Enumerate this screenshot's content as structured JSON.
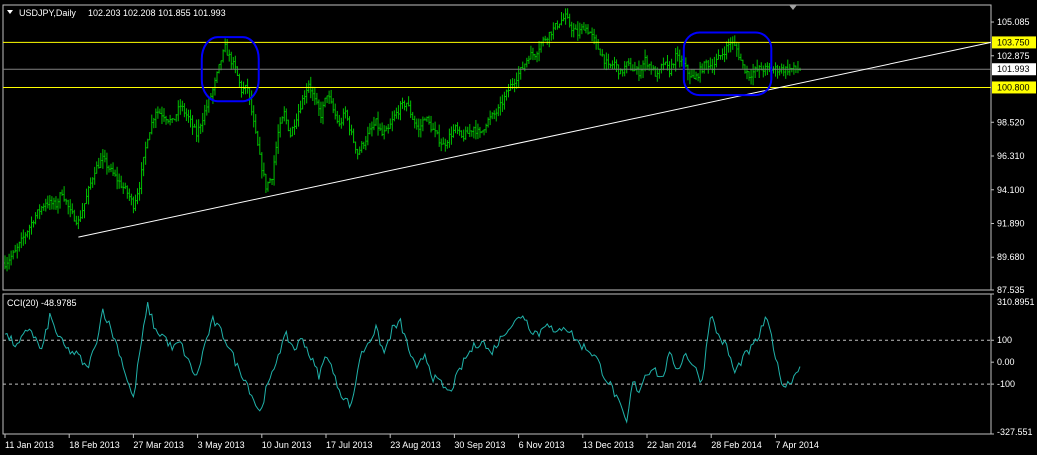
{
  "header": {
    "symbol": "USDJPY,Daily",
    "ohlc": "102.203 102.208 101.855 101.993",
    "menu_icon": "triangle-down-icon"
  },
  "indicator": {
    "label": "CCI(20) -48.9785"
  },
  "colors": {
    "background": "#000000",
    "frame": "#c0c0c0",
    "bars": "#00c000",
    "cci": "#20b2aa",
    "support_line": "#ffffff",
    "level_line": "#ffff00",
    "ellipse": "#0000ff",
    "axis_text": "#ffffff",
    "level_label_bg": "#ffff00",
    "level_label_text": "#000000"
  },
  "chart_data": [
    {
      "type": "ohlc",
      "ylim": [
        87.535,
        106.2
      ],
      "y_ticks": [
        "105.085",
        "102.875",
        "98.520",
        "96.310",
        "94.100",
        "91.890",
        "89.680",
        "87.535"
      ],
      "x_ticks": [
        "11 Jan 2013",
        "18 Feb 2013",
        "27 Mar 2013",
        "3 May 2013",
        "10 Jun 2013",
        "17 Jul 2013",
        "23 Aug 2013",
        "30 Sep 2013",
        "6 Nov 2013",
        "13 Dec 2013",
        "22 Jan 2014",
        "28 Feb 2014",
        "7 Apr 2014"
      ],
      "close_path": [
        [
          0,
          89.3
        ],
        [
          5,
          90.0
        ],
        [
          10,
          91.2
        ],
        [
          15,
          92.4
        ],
        [
          20,
          93.3
        ],
        [
          25,
          93.1
        ],
        [
          28,
          94.0
        ],
        [
          32,
          92.6
        ],
        [
          36,
          92.0
        ],
        [
          40,
          93.6
        ],
        [
          44,
          95.4
        ],
        [
          48,
          96.1
        ],
        [
          52,
          95.3
        ],
        [
          56,
          94.6
        ],
        [
          60,
          93.9
        ],
        [
          63,
          93.1
        ],
        [
          66,
          94.4
        ],
        [
          70,
          97.6
        ],
        [
          74,
          99.3
        ],
        [
          78,
          99.0
        ],
        [
          82,
          98.5
        ],
        [
          86,
          99.6
        ],
        [
          90,
          98.8
        ],
        [
          94,
          97.7
        ],
        [
          98,
          99.2
        ],
        [
          102,
          100.6
        ],
        [
          106,
          102.6
        ],
        [
          108,
          103.4
        ],
        [
          110,
          102.8
        ],
        [
          113,
          102.0
        ],
        [
          116,
          100.6
        ],
        [
          119,
          100.8
        ],
        [
          122,
          98.4
        ],
        [
          125,
          96.2
        ],
        [
          128,
          94.3
        ],
        [
          131,
          95.0
        ],
        [
          134,
          97.8
        ],
        [
          137,
          99.1
        ],
        [
          140,
          97.7
        ],
        [
          143,
          98.9
        ],
        [
          146,
          100.0
        ],
        [
          149,
          101.1
        ],
        [
          152,
          99.9
        ],
        [
          155,
          99.0
        ],
        [
          158,
          100.4
        ],
        [
          161,
          99.3
        ],
        [
          164,
          98.3
        ],
        [
          167,
          99.2
        ],
        [
          170,
          97.7
        ],
        [
          173,
          96.5
        ],
        [
          176,
          97.2
        ],
        [
          179,
          97.9
        ],
        [
          182,
          98.5
        ],
        [
          185,
          97.7
        ],
        [
          188,
          98.0
        ],
        [
          191,
          98.9
        ],
        [
          194,
          99.5
        ],
        [
          197,
          99.8
        ],
        [
          200,
          98.8
        ],
        [
          203,
          98.0
        ],
        [
          206,
          98.9
        ],
        [
          209,
          98.2
        ],
        [
          212,
          97.6
        ],
        [
          215,
          97.0
        ],
        [
          218,
          97.6
        ],
        [
          221,
          98.1
        ],
        [
          224,
          97.5
        ],
        [
          227,
          97.8
        ],
        [
          230,
          98.2
        ],
        [
          233,
          97.7
        ],
        [
          236,
          98.5
        ],
        [
          239,
          98.9
        ],
        [
          242,
          99.3
        ],
        [
          245,
          100.1
        ],
        [
          248,
          100.9
        ],
        [
          251,
          101.5
        ],
        [
          254,
          102.1
        ],
        [
          257,
          102.9
        ],
        [
          260,
          103.0
        ],
        [
          263,
          103.7
        ],
        [
          266,
          104.2
        ],
        [
          269,
          104.6
        ],
        [
          272,
          105.1
        ],
        [
          275,
          105.4
        ],
        [
          278,
          104.7
        ],
        [
          281,
          104.3
        ],
        [
          284,
          104.8
        ],
        [
          287,
          104.4
        ],
        [
          290,
          103.6
        ],
        [
          293,
          102.9
        ],
        [
          296,
          102.1
        ],
        [
          299,
          102.4
        ],
        [
          302,
          101.7
        ],
        [
          305,
          102.3
        ],
        [
          308,
          102.0
        ],
        [
          311,
          101.8
        ],
        [
          314,
          102.6
        ],
        [
          317,
          102.1
        ],
        [
          320,
          101.5
        ],
        [
          323,
          102.4
        ],
        [
          326,
          101.9
        ],
        [
          329,
          102.8
        ],
        [
          332,
          102.5
        ],
        [
          335,
          101.8
        ],
        [
          338,
          101.3
        ],
        [
          341,
          101.9
        ],
        [
          344,
          102.4
        ],
        [
          347,
          102.2
        ],
        [
          350,
          102.7
        ],
        [
          353,
          103.2
        ],
        [
          356,
          103.8
        ],
        [
          359,
          103.3
        ],
        [
          362,
          102.2
        ],
        [
          365,
          101.6
        ],
        [
          368,
          101.9
        ],
        [
          370,
          102.0
        ]
      ],
      "levels": [
        "103.750",
        "101.993",
        "100.800"
      ],
      "support_line": {
        "from": [
          36,
          91.0
        ],
        "to": [
          472,
          103.75
        ]
      }
    },
    {
      "type": "line",
      "name": "CCI(20)",
      "ylim": [
        -327.551,
        310.8951
      ],
      "y_ticks": [
        "310.8951",
        "100",
        "0.00",
        "-100",
        "-327.551"
      ],
      "levels": [
        100,
        -100
      ],
      "x_ticks": [
        "11 Jan 2013",
        "18 Feb 2013",
        "27 Mar 2013",
        "3 May 2013",
        "10 Jun 2013",
        "17 Jul 2013",
        "23 Aug 2013",
        "30 Sep 2013",
        "6 Nov 2013",
        "13 Dec 2013",
        "22 Jan 2014",
        "28 Feb 2014",
        "7 Apr 2014"
      ],
      "values": [
        [
          0,
          130
        ],
        [
          6,
          70
        ],
        [
          12,
          160
        ],
        [
          18,
          50
        ],
        [
          22,
          210
        ],
        [
          26,
          120
        ],
        [
          30,
          60
        ],
        [
          36,
          30
        ],
        [
          40,
          -30
        ],
        [
          44,
          60
        ],
        [
          48,
          240
        ],
        [
          52,
          150
        ],
        [
          56,
          50
        ],
        [
          60,
          -80
        ],
        [
          63,
          -170
        ],
        [
          66,
          40
        ],
        [
          70,
          260
        ],
        [
          74,
          140
        ],
        [
          78,
          120
        ],
        [
          82,
          60
        ],
        [
          86,
          90
        ],
        [
          90,
          0
        ],
        [
          94,
          -70
        ],
        [
          98,
          80
        ],
        [
          102,
          190
        ],
        [
          106,
          140
        ],
        [
          110,
          70
        ],
        [
          114,
          -20
        ],
        [
          118,
          -80
        ],
        [
          122,
          -170
        ],
        [
          125,
          -230
        ],
        [
          128,
          -130
        ],
        [
          131,
          -60
        ],
        [
          134,
          40
        ],
        [
          138,
          120
        ],
        [
          142,
          60
        ],
        [
          146,
          110
        ],
        [
          150,
          20
        ],
        [
          154,
          -60
        ],
        [
          158,
          40
        ],
        [
          162,
          -80
        ],
        [
          166,
          -160
        ],
        [
          170,
          -200
        ],
        [
          174,
          20
        ],
        [
          178,
          90
        ],
        [
          182,
          150
        ],
        [
          186,
          40
        ],
        [
          190,
          150
        ],
        [
          194,
          180
        ],
        [
          198,
          60
        ],
        [
          202,
          -40
        ],
        [
          206,
          40
        ],
        [
          210,
          -70
        ],
        [
          214,
          -100
        ],
        [
          218,
          -140
        ],
        [
          222,
          -60
        ],
        [
          226,
          20
        ],
        [
          230,
          70
        ],
        [
          234,
          100
        ],
        [
          238,
          40
        ],
        [
          242,
          90
        ],
        [
          246,
          150
        ],
        [
          250,
          180
        ],
        [
          254,
          220
        ],
        [
          258,
          150
        ],
        [
          262,
          130
        ],
        [
          266,
          190
        ],
        [
          270,
          120
        ],
        [
          274,
          170
        ],
        [
          278,
          130
        ],
        [
          282,
          80
        ],
        [
          286,
          60
        ],
        [
          290,
          20
        ],
        [
          294,
          -60
        ],
        [
          298,
          -120
        ],
        [
          302,
          -210
        ],
        [
          305,
          -280
        ],
        [
          308,
          -90
        ],
        [
          311,
          -130
        ],
        [
          314,
          -60
        ],
        [
          318,
          -20
        ],
        [
          322,
          -80
        ],
        [
          326,
          30
        ],
        [
          330,
          -30
        ],
        [
          334,
          40
        ],
        [
          338,
          -20
        ],
        [
          342,
          -90
        ],
        [
          346,
          220
        ],
        [
          350,
          120
        ],
        [
          354,
          70
        ],
        [
          358,
          -50
        ],
        [
          362,
          20
        ],
        [
          366,
          60
        ],
        [
          370,
          120
        ],
        [
          373,
          200
        ],
        [
          376,
          120
        ],
        [
          379,
          -20
        ],
        [
          382,
          -110
        ],
        [
          385,
          -90
        ],
        [
          388,
          -50
        ],
        [
          390,
          -20
        ]
      ]
    }
  ]
}
